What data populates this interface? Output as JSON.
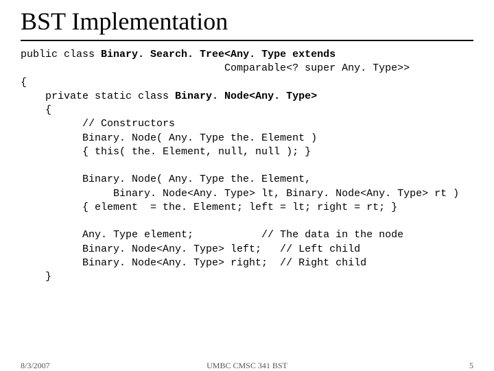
{
  "title": "BST Implementation",
  "code": {
    "l1a": "public class ",
    "l1b": "Binary. Search. Tree<Any. Type extends",
    "l2": "                                 Comparable<? super Any. Type>>",
    "l3": "{",
    "l4a": "    private static class ",
    "l4b": "Binary. Node<Any. Type>",
    "l5": "    {",
    "l6": "          // Constructors",
    "l7": "          Binary. Node( Any. Type the. Element )",
    "l8": "          { this( the. Element, null, null ); }",
    "l9": "",
    "l10": "          Binary. Node( Any. Type the. Element,",
    "l11": "               Binary. Node<Any. Type> lt, Binary. Node<Any. Type> rt )",
    "l12": "          { element  = the. Element; left = lt; right = rt; }",
    "l13": "",
    "l14": "          Any. Type element;           // The data in the node",
    "l15": "          Binary. Node<Any. Type> left;   // Left child",
    "l16": "          Binary. Node<Any. Type> right;  // Right child",
    "l17": "    }"
  },
  "footer": {
    "date": "8/3/2007",
    "center": "UMBC CMSC 341 BST",
    "page": "5"
  }
}
